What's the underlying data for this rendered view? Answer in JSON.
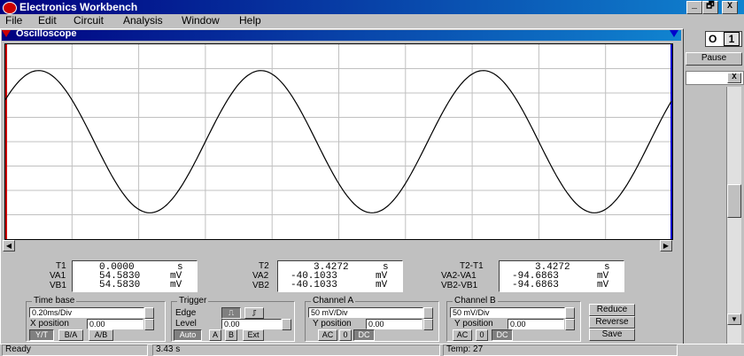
{
  "app": {
    "title": "Electronics Workbench"
  },
  "menu": {
    "items": [
      "File",
      "Edit",
      "Circuit",
      "Analysis",
      "Window",
      "Help"
    ]
  },
  "window_controls": {
    "minimize": "_",
    "restore": "🗗",
    "close": "X"
  },
  "power_switch": {
    "off": "O",
    "on": "1"
  },
  "pause_button": {
    "label": "Pause"
  },
  "oscilloscope": {
    "title": "Oscilloscope",
    "marker_t1": "1",
    "marker_t2": "2",
    "readouts": {
      "t1": {
        "label": "T1",
        "value": "0.0000",
        "unit": "s"
      },
      "va1": {
        "label": "VA1",
        "value": "54.5830",
        "unit": "mV"
      },
      "vb1": {
        "label": "VB1",
        "value": "54.5830",
        "unit": "mV"
      },
      "t2": {
        "label": "T2",
        "value": "3.4272",
        "unit": "s"
      },
      "va2": {
        "label": "VA2",
        "value": "-40.1033",
        "unit": "mV"
      },
      "vb2": {
        "label": "VB2",
        "value": "-40.1033",
        "unit": "mV"
      },
      "t2t1": {
        "label": "T2-T1",
        "value": "3.4272",
        "unit": "s"
      },
      "va2va1": {
        "label": "VA2-VA1",
        "value": "-94.6863",
        "unit": "mV"
      },
      "vb2vb1": {
        "label": "VB2-VB1",
        "value": "-94.6863",
        "unit": "mV"
      }
    },
    "time_base": {
      "title": "Time base",
      "value": "0.20ms/Div",
      "x_position_label": "X position",
      "x_position": "0.00",
      "buttons": [
        "Y/T",
        "B/A",
        "A/B"
      ],
      "active": "Y/T"
    },
    "trigger": {
      "title": "Trigger",
      "edge_label": "Edge",
      "level_label": "Level",
      "level": "0.00",
      "buttons": [
        "Auto",
        "A",
        "B",
        "Ext"
      ],
      "active": "Auto"
    },
    "channel_a": {
      "title": "Channel A",
      "value": "50 mV/Div",
      "y_position_label": "Y position",
      "y_position": "0.00",
      "buttons": [
        "AC",
        "0",
        "DC"
      ],
      "active": "DC"
    },
    "channel_b": {
      "title": "Channel B",
      "value": "50 mV/Div",
      "y_position_label": "Y position",
      "y_position": "0.00",
      "buttons": [
        "AC",
        "0",
        "DC"
      ],
      "active": "DC"
    },
    "actions": [
      "Reduce",
      "Reverse",
      "Save"
    ],
    "trace": {
      "color": "#000000",
      "grid_color": "#c0c0c0",
      "cycles": 3.0,
      "amplitude": 0.73,
      "phase": 0.63
    }
  },
  "status": {
    "left": "Ready",
    "time": "3.43 s",
    "temp": "Temp:  27"
  }
}
